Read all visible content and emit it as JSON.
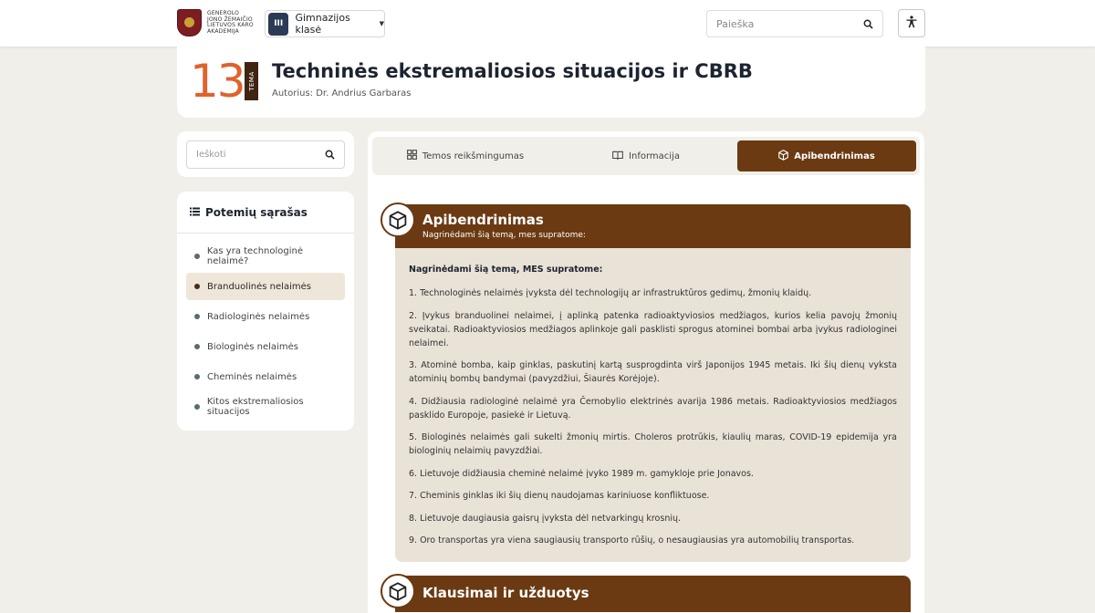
{
  "header": {
    "logo_text": "Generolo Jono Žemaičio Lietuvos karo akademija",
    "class_badge": "III",
    "class_select": "Gimnazijos klasė",
    "search_placeholder": "Paieška"
  },
  "title_card": {
    "number": "13",
    "tema_label": "TEMA",
    "title": "Techninės ekstremaliosios situacijos ir CBRB",
    "author": "Autorius: Dr. Andrius Garbaras"
  },
  "sidebar": {
    "search_placeholder": "Ieškoti",
    "topics_title": "Potemių sąrašas",
    "items": [
      {
        "label": "Kas yra technologinė nelaimė?"
      },
      {
        "label": "Branduolinės nelaimės",
        "active": true
      },
      {
        "label": "Radiologinės nelaimės"
      },
      {
        "label": "Biologinės nelaimės"
      },
      {
        "label": "Cheminės nelaimės"
      },
      {
        "label": "Kitos ekstremaliosios situacijos"
      }
    ]
  },
  "tabs": [
    {
      "label": "Temos reikšmingumas",
      "icon": "grid-icon"
    },
    {
      "label": "Informacija",
      "icon": "book-icon"
    },
    {
      "label": "Apibendrinimas",
      "icon": "cube-icon",
      "active": true
    }
  ],
  "summary": {
    "title": "Apibendrinimas",
    "subtitle": "Nagrinėdami šią temą, mes supratome:",
    "intro": "Nagrinėdami šią temą, MES supratome:",
    "items": [
      "1. Technologinės nelaimės įvyksta dėl technologijų ar infrastruktūros gedimų, žmonių klaidų.",
      "2. Įvykus branduolinei nelaimei, į aplinką patenka radioaktyviosios medžiagos, kurios kelia pavojų žmonių sveikatai. Radioaktyviosios medžiagos aplinkoje gali pasklisti sprogus atominei bombai arba įvykus radiologinei nelaimei.",
      "3. Atominė bomba, kaip ginklas, paskutinį kartą susprogdinta virš Japonijos 1945 metais. Iki šių dienų vyksta atominių bombų bandymai (pavyzdžiui, Šiaurės Korėjoje).",
      "4. Didžiausia radiologinė nelaimė yra Černobylio elektrinės avarija 1986 metais. Radioaktyviosios medžiagos pasklido Europoje, pasiekė ir Lietuvą.",
      "5. Biologinės nelaimės gali sukelti žmonių mirtis. Choleros protrūkis, kiaulių maras, COVID-19 epidemija yra biologinių nelaimių pavyzdžiai.",
      "6. Lietuvoje didžiausia cheminė nelaimė įvyko 1989 m. gamykloje prie Jonavos.",
      "7. Cheminis ginklas iki šių dienų naudojamas kariniuose konfliktuose.",
      "8. Lietuvoje daugiausia gaisrų įvyksta dėl netvarkingų krosnių.",
      "9. Oro transportas yra viena saugiausių transporto rūšių, o nesaugiausias yra automobilių transportas."
    ]
  },
  "questions": {
    "title": "Klausimai ir užduotys"
  },
  "colors": {
    "brand_brown": "#6b3a12",
    "accent_orange": "#e0622d",
    "summary_bg": "#e9e2d7",
    "page_bg": "#f1efe9"
  }
}
